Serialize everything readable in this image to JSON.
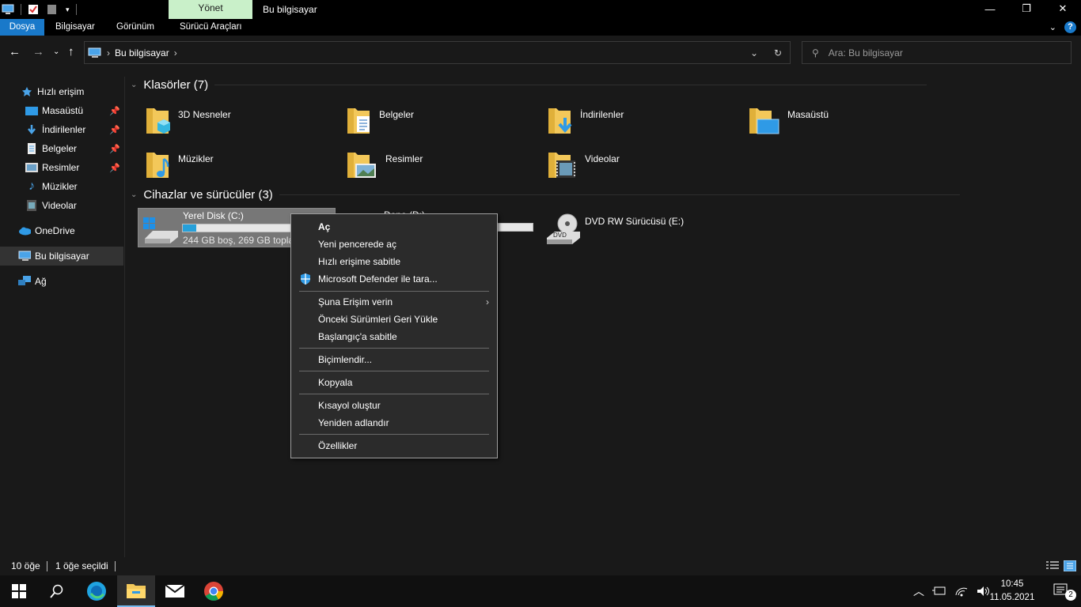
{
  "window": {
    "title": "Bu bilgisayar",
    "contextual_tab": "Yönet",
    "controls": {
      "minimize": "—",
      "maximize": "❐",
      "close": "✕"
    }
  },
  "ribbon": {
    "tabs": [
      {
        "label": "Dosya",
        "active": true
      },
      {
        "label": "Bilgisayar"
      },
      {
        "label": "Görünüm"
      },
      {
        "label": "Sürücü Araçları"
      }
    ]
  },
  "address": {
    "path": "Bu bilgisayar",
    "search_placeholder": "Ara: Bu bilgisayar"
  },
  "sidebar": {
    "items": [
      {
        "label": "Hızlı erişim"
      },
      {
        "label": "Masaüstü"
      },
      {
        "label": "İndirilenler"
      },
      {
        "label": "Belgeler"
      },
      {
        "label": "Resimler"
      },
      {
        "label": "Müzikler"
      },
      {
        "label": "Videolar"
      },
      {
        "label": "OneDrive"
      },
      {
        "label": "Bu bilgisayar"
      },
      {
        "label": "Ağ"
      }
    ]
  },
  "content": {
    "folders_header": "Klasörler (7)",
    "folders": [
      {
        "label": "3D Nesneler"
      },
      {
        "label": "Belgeler"
      },
      {
        "label": "İndirilenler"
      },
      {
        "label": "Masaüstü"
      },
      {
        "label": "Müzikler"
      },
      {
        "label": "Resimler"
      },
      {
        "label": "Videolar"
      }
    ],
    "devices_header": "Cihazlar ve sürücüler (3)",
    "drives": [
      {
        "name": "Yerel Disk (C:)",
        "free_text": "244 GB boş, 269 GB toplam",
        "used_fraction": 0.093
      },
      {
        "name": "Depo (D:)",
        "used_fraction": 0.0
      },
      {
        "name": "DVD RW Sürücüsü (E:)"
      }
    ]
  },
  "context_menu": {
    "items": [
      {
        "label": "Aç",
        "bold": true
      },
      {
        "label": "Yeni pencerede aç"
      },
      {
        "label": "Hızlı erişime sabitle"
      },
      {
        "label": "Microsoft Defender ile tara..."
      },
      {
        "label": "Şuna Erişim verin"
      },
      {
        "label": "Önceki Sürümleri Geri Yükle"
      },
      {
        "label": "Başlangıç'a sabitle"
      },
      {
        "label": "Biçimlendir..."
      },
      {
        "label": "Kopyala"
      },
      {
        "label": "Kısayol oluştur"
      },
      {
        "label": "Yeniden adlandır"
      },
      {
        "label": "Özellikler"
      }
    ]
  },
  "status": {
    "item_count": "10 öğe",
    "selected": "1 öğe seçildi"
  },
  "taskbar": {
    "time": "10:45",
    "date": "11.05.2021",
    "notification_count": "2"
  },
  "colors": {
    "accent": "#1979ca",
    "contextual_tab_bg": "#c9f0c9",
    "folder": "#f3c85a",
    "drive_bar": "#26a0da"
  }
}
